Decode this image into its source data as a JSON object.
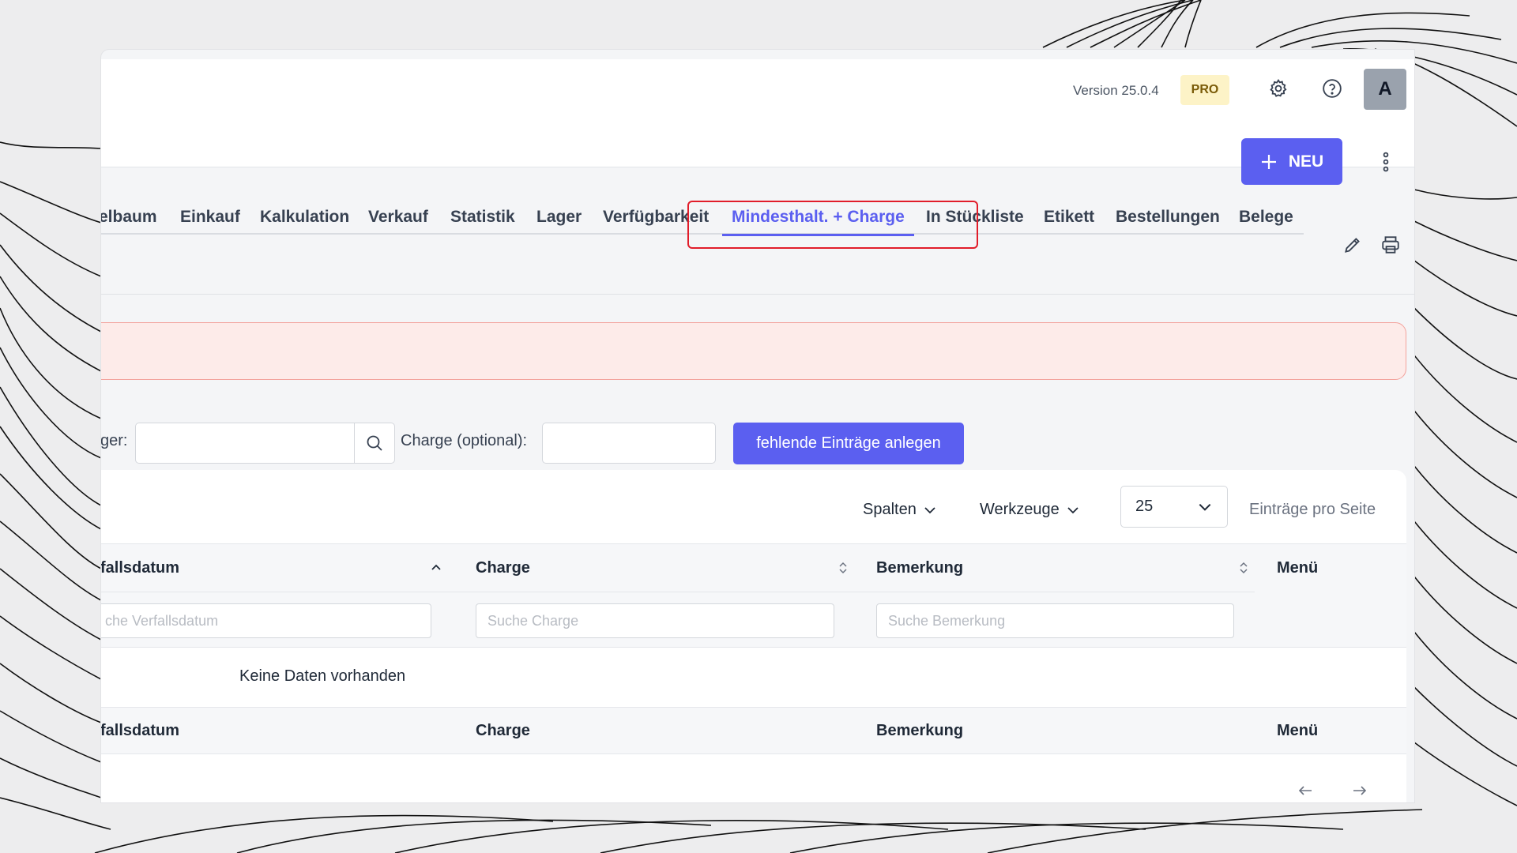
{
  "header": {
    "version": "Version 25.0.4",
    "plan_badge": "PRO",
    "avatar_initial": "A"
  },
  "actions": {
    "new_button": "NEU"
  },
  "tabs": [
    {
      "label": "elbaum"
    },
    {
      "label": "Einkauf"
    },
    {
      "label": "Kalkulation"
    },
    {
      "label": "Verkauf"
    },
    {
      "label": "Statistik"
    },
    {
      "label": "Lager"
    },
    {
      "label": "Verfügbarkeit"
    },
    {
      "label": "Mindesthalt. + Charge",
      "active": true
    },
    {
      "label": "In Stückliste"
    },
    {
      "label": "Etikett"
    },
    {
      "label": "Bestellungen"
    },
    {
      "label": "Belege"
    }
  ],
  "filters": {
    "lager_label": "ger:",
    "charge_label": "Charge (optional):",
    "create_button": "fehlende Einträge anlegen"
  },
  "table_toolbar": {
    "columns": "Spalten",
    "tools": "Werkzeuge",
    "per_page_value": "25",
    "per_page_label": "Einträge pro Seite"
  },
  "table": {
    "headers": [
      "fallsdatum",
      "Charge",
      "Bemerkung",
      "Menü"
    ],
    "search_placeholders": [
      "che Verfallsdatum",
      "Suche Charge",
      "Suche Bemerkung"
    ],
    "empty_text": "Keine Daten vorhanden"
  },
  "colors": {
    "accent": "#5b5ff0",
    "highlight": "#e11d2a",
    "alert_bg": "#fdebe9"
  }
}
